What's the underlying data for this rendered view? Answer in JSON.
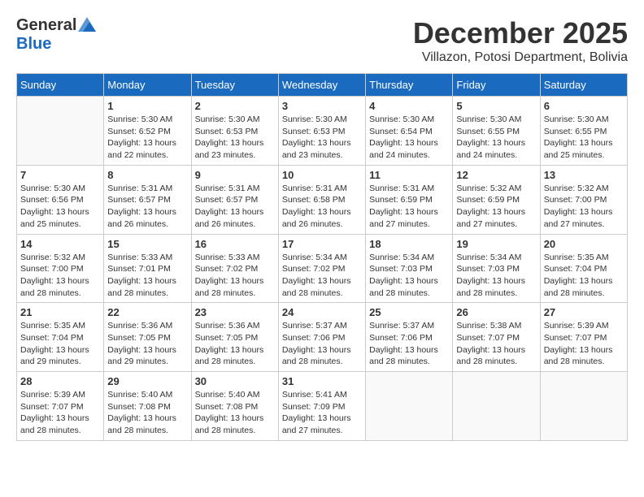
{
  "header": {
    "logo_general": "General",
    "logo_blue": "Blue",
    "month_title": "December 2025",
    "location": "Villazon, Potosi Department, Bolivia"
  },
  "days_of_week": [
    "Sunday",
    "Monday",
    "Tuesday",
    "Wednesday",
    "Thursday",
    "Friday",
    "Saturday"
  ],
  "weeks": [
    [
      {
        "day": "",
        "info": ""
      },
      {
        "day": "1",
        "info": "Sunrise: 5:30 AM\nSunset: 6:52 PM\nDaylight: 13 hours\nand 22 minutes."
      },
      {
        "day": "2",
        "info": "Sunrise: 5:30 AM\nSunset: 6:53 PM\nDaylight: 13 hours\nand 23 minutes."
      },
      {
        "day": "3",
        "info": "Sunrise: 5:30 AM\nSunset: 6:53 PM\nDaylight: 13 hours\nand 23 minutes."
      },
      {
        "day": "4",
        "info": "Sunrise: 5:30 AM\nSunset: 6:54 PM\nDaylight: 13 hours\nand 24 minutes."
      },
      {
        "day": "5",
        "info": "Sunrise: 5:30 AM\nSunset: 6:55 PM\nDaylight: 13 hours\nand 24 minutes."
      },
      {
        "day": "6",
        "info": "Sunrise: 5:30 AM\nSunset: 6:55 PM\nDaylight: 13 hours\nand 25 minutes."
      }
    ],
    [
      {
        "day": "7",
        "info": "Sunrise: 5:30 AM\nSunset: 6:56 PM\nDaylight: 13 hours\nand 25 minutes."
      },
      {
        "day": "8",
        "info": "Sunrise: 5:31 AM\nSunset: 6:57 PM\nDaylight: 13 hours\nand 26 minutes."
      },
      {
        "day": "9",
        "info": "Sunrise: 5:31 AM\nSunset: 6:57 PM\nDaylight: 13 hours\nand 26 minutes."
      },
      {
        "day": "10",
        "info": "Sunrise: 5:31 AM\nSunset: 6:58 PM\nDaylight: 13 hours\nand 26 minutes."
      },
      {
        "day": "11",
        "info": "Sunrise: 5:31 AM\nSunset: 6:59 PM\nDaylight: 13 hours\nand 27 minutes."
      },
      {
        "day": "12",
        "info": "Sunrise: 5:32 AM\nSunset: 6:59 PM\nDaylight: 13 hours\nand 27 minutes."
      },
      {
        "day": "13",
        "info": "Sunrise: 5:32 AM\nSunset: 7:00 PM\nDaylight: 13 hours\nand 27 minutes."
      }
    ],
    [
      {
        "day": "14",
        "info": "Sunrise: 5:32 AM\nSunset: 7:00 PM\nDaylight: 13 hours\nand 28 minutes."
      },
      {
        "day": "15",
        "info": "Sunrise: 5:33 AM\nSunset: 7:01 PM\nDaylight: 13 hours\nand 28 minutes."
      },
      {
        "day": "16",
        "info": "Sunrise: 5:33 AM\nSunset: 7:02 PM\nDaylight: 13 hours\nand 28 minutes."
      },
      {
        "day": "17",
        "info": "Sunrise: 5:34 AM\nSunset: 7:02 PM\nDaylight: 13 hours\nand 28 minutes."
      },
      {
        "day": "18",
        "info": "Sunrise: 5:34 AM\nSunset: 7:03 PM\nDaylight: 13 hours\nand 28 minutes."
      },
      {
        "day": "19",
        "info": "Sunrise: 5:34 AM\nSunset: 7:03 PM\nDaylight: 13 hours\nand 28 minutes."
      },
      {
        "day": "20",
        "info": "Sunrise: 5:35 AM\nSunset: 7:04 PM\nDaylight: 13 hours\nand 28 minutes."
      }
    ],
    [
      {
        "day": "21",
        "info": "Sunrise: 5:35 AM\nSunset: 7:04 PM\nDaylight: 13 hours\nand 29 minutes."
      },
      {
        "day": "22",
        "info": "Sunrise: 5:36 AM\nSunset: 7:05 PM\nDaylight: 13 hours\nand 29 minutes."
      },
      {
        "day": "23",
        "info": "Sunrise: 5:36 AM\nSunset: 7:05 PM\nDaylight: 13 hours\nand 28 minutes."
      },
      {
        "day": "24",
        "info": "Sunrise: 5:37 AM\nSunset: 7:06 PM\nDaylight: 13 hours\nand 28 minutes."
      },
      {
        "day": "25",
        "info": "Sunrise: 5:37 AM\nSunset: 7:06 PM\nDaylight: 13 hours\nand 28 minutes."
      },
      {
        "day": "26",
        "info": "Sunrise: 5:38 AM\nSunset: 7:07 PM\nDaylight: 13 hours\nand 28 minutes."
      },
      {
        "day": "27",
        "info": "Sunrise: 5:39 AM\nSunset: 7:07 PM\nDaylight: 13 hours\nand 28 minutes."
      }
    ],
    [
      {
        "day": "28",
        "info": "Sunrise: 5:39 AM\nSunset: 7:07 PM\nDaylight: 13 hours\nand 28 minutes."
      },
      {
        "day": "29",
        "info": "Sunrise: 5:40 AM\nSunset: 7:08 PM\nDaylight: 13 hours\nand 28 minutes."
      },
      {
        "day": "30",
        "info": "Sunrise: 5:40 AM\nSunset: 7:08 PM\nDaylight: 13 hours\nand 28 minutes."
      },
      {
        "day": "31",
        "info": "Sunrise: 5:41 AM\nSunset: 7:09 PM\nDaylight: 13 hours\nand 27 minutes."
      },
      {
        "day": "",
        "info": ""
      },
      {
        "day": "",
        "info": ""
      },
      {
        "day": "",
        "info": ""
      }
    ]
  ]
}
